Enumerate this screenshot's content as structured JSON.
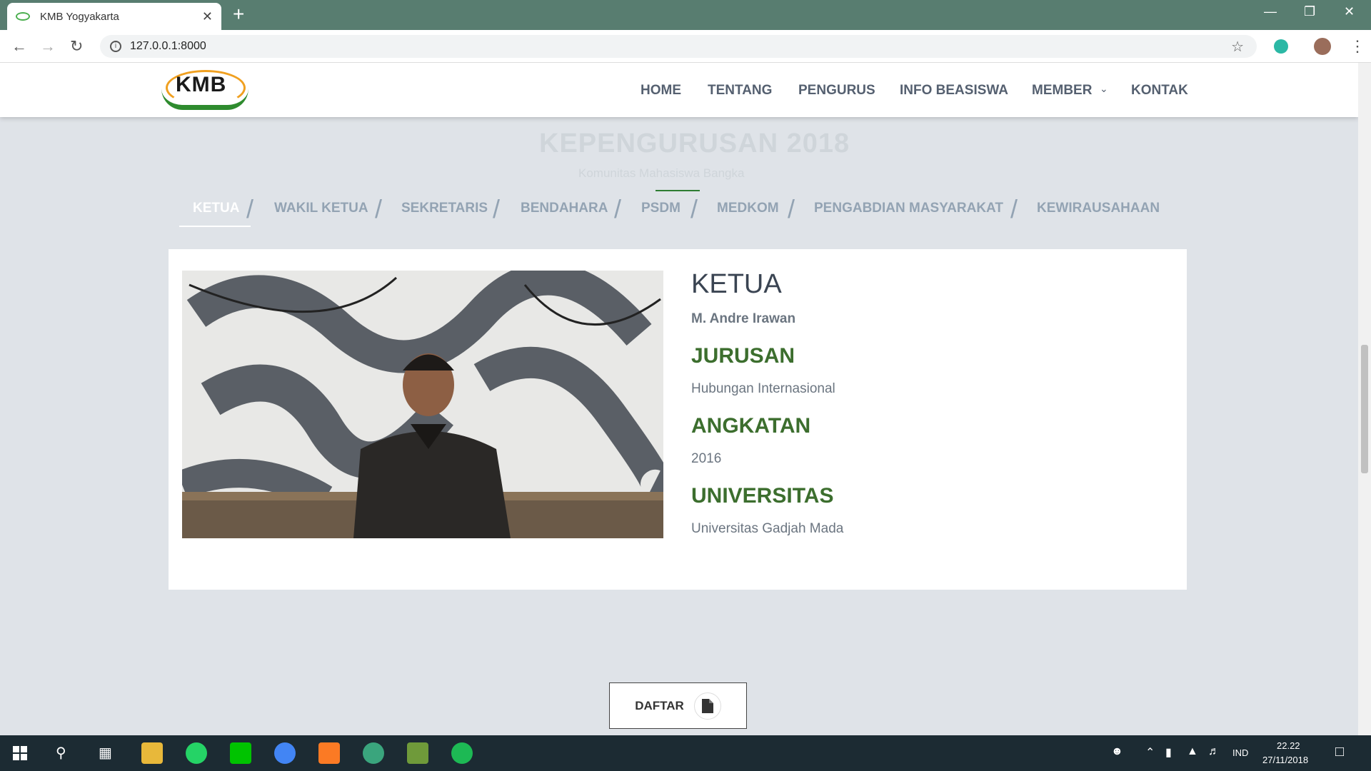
{
  "browser": {
    "tab_title": "KMB Yogyakarta",
    "url": "127.0.0.1:8000",
    "close_tab": "✕",
    "new_tab": "+"
  },
  "site": {
    "logo_text": "KMB",
    "nav": [
      "HOME",
      "TENTANG",
      "PENGURUS",
      "INFO BEASISWA",
      "MEMBER",
      "KONTAK"
    ],
    "section_title": "KEPENGURUSAN 2018",
    "section_subtitle": "Komunitas Mahasiswa Bangka"
  },
  "tabs": [
    "KETUA",
    "WAKIL KETUA",
    "SEKRETARIS",
    "BENDAHARA",
    "PSDM",
    "MEDKOM",
    "PENGABDIAN MASYARAKAT",
    "KEWIRAUSAHAAN"
  ],
  "active_tab": "KETUA",
  "profile": {
    "role": "KETUA",
    "name": "M. Andre Irawan",
    "jurusan_label": "JURUSAN",
    "jurusan": "Hubungan Internasional",
    "angkatan_label": "ANGKATAN",
    "angkatan": "2016",
    "universitas_label": "UNIVERSITAS",
    "universitas": "Universitas Gadjah Mada"
  },
  "daftar_button": "DAFTAR",
  "taskbar": {
    "language": "IND",
    "time": "22.22",
    "date": "27/11/2018"
  },
  "colors": {
    "chrome_tabbar": "#587d70",
    "accent_green": "#3c6e2e",
    "taskbar": "#1c2b33"
  }
}
